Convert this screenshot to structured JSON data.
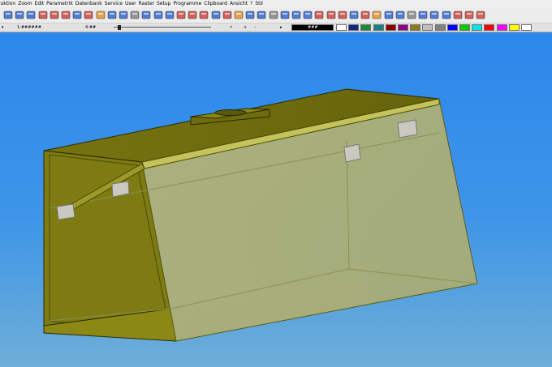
{
  "menubar": {
    "items": [
      "ruktion",
      "Zoom",
      "Edit",
      "Parametrik",
      "Datenbank",
      "Service",
      "User",
      "Raster",
      "Setup",
      "Programme",
      "Clipboard",
      "Ansicht",
      "?",
      "Stil"
    ]
  },
  "statusbar": {
    "field_a": "1:######",
    "field_b": "4:##",
    "field_c": "###",
    "swatches": [
      "#000000",
      "#ffffff",
      "#0e2a80",
      "#1a8a3a",
      "#138383",
      "#8b0000",
      "#8b008b",
      "#8a7a20",
      "#c0c0c0",
      "#808080",
      "#0000ff",
      "#00cc00",
      "#00e5e5",
      "#ff0000",
      "#ff00ff",
      "#ffff00",
      "#ffffff"
    ]
  },
  "toolbar": {
    "icons": [
      "select-icon",
      "undo-icon",
      "redo-icon",
      "grid-icon",
      "measure-icon",
      "measure-icon",
      "tool-icon",
      "trim-icon",
      "light-icon",
      "tool-icon",
      "select-icon",
      "wrench-icon",
      "view-icon",
      "3d-icon",
      "3d-icon",
      "3d-icon",
      "cube-icon",
      "solid-icon",
      "solid-icon",
      "pipe-icon",
      "cylinder-icon",
      "cylinder-icon",
      "cylinder-icon",
      "cylinder-icon",
      "doc-icon",
      "doc-icon",
      "opcl-icon",
      "sheet-icon",
      "doc-icon",
      "doc-icon",
      "render-icon",
      "solid-icon",
      "layer-icon",
      "layer-icon",
      "print-icon",
      "export-icon",
      "view-icon",
      "view-icon",
      "view-icon",
      "snap-icon",
      "cone-icon",
      "pin-icon"
    ]
  },
  "colors": {
    "viewport_top": "#2c87eb",
    "viewport_bottom": "#6eaed7",
    "body_olive": "#7c7a10",
    "top_olive": "#6d6a0e",
    "glass": "#c9c98a"
  }
}
